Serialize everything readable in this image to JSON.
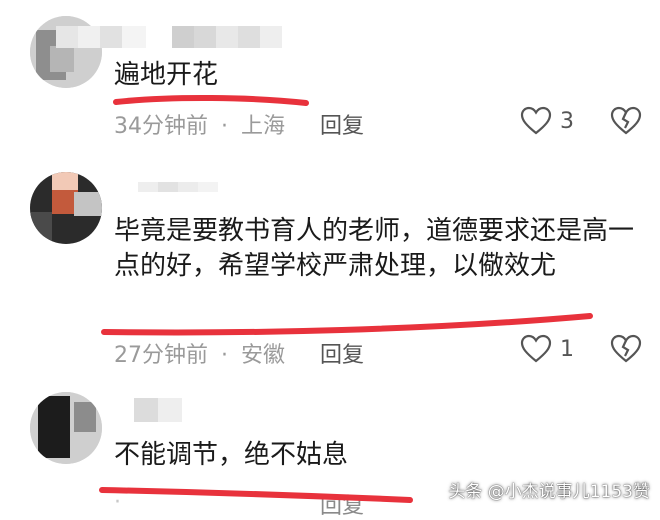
{
  "comments": [
    {
      "text": "遍地开花",
      "time": "34分钟前",
      "location": "上海",
      "reply_label": "回复",
      "likes": "3"
    },
    {
      "text": "毕竟是要教书育人的老师，道德要求还是高一点的好，希望学校严肃处理，以儆效尤",
      "time": "27分钟前",
      "location": "安徽",
      "reply_label": "回复",
      "likes": "1"
    },
    {
      "text": "不能调节，绝不姑息",
      "reply_label": "回复"
    }
  ],
  "meta_separator": "·",
  "watermark": "头条 @小杰说事儿1153赞",
  "colors": {
    "highlight": "#e8323c",
    "meta": "#9a9a9a",
    "text": "#1a1a1a"
  },
  "icons": {
    "like": "heart-outline-icon",
    "dislike": "broken-heart-icon"
  }
}
